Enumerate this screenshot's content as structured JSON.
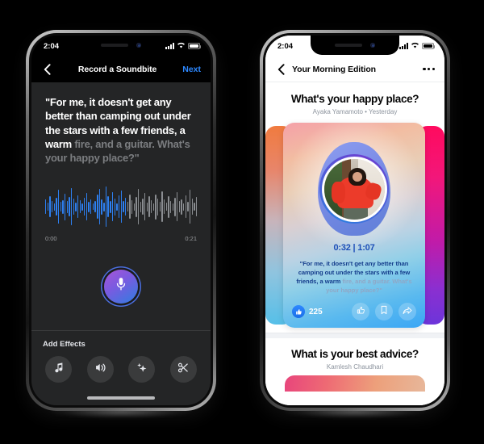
{
  "status_bar": {
    "time": "2:04",
    "signal_icon": "cellular-bars-icon",
    "wifi_icon": "wifi-icon",
    "battery_icon": "battery-icon"
  },
  "left_phone": {
    "nav": {
      "back_icon": "back-chevron-icon",
      "title": "Record a Soundbite",
      "next_label": "Next"
    },
    "transcript": {
      "spoken": "\"For me, it doesn't get any better than camping out under the stars with a few friends, a warm ",
      "remaining": "fire, and a guitar. What's your happy place?\""
    },
    "waveform": {
      "start_time": "0:00",
      "end_time": "0:21",
      "played_color": "#2d7ff0",
      "unplayed_color": "#8a8d91",
      "played_count": 38,
      "heights": [
        18,
        10,
        26,
        14,
        9,
        22,
        42,
        12,
        17,
        33,
        15,
        24,
        46,
        20,
        11,
        28,
        16,
        9,
        22,
        34,
        13,
        18,
        8,
        14,
        30,
        44,
        19,
        11,
        50,
        26,
        15,
        36,
        21,
        9,
        28,
        40,
        14,
        22,
        12,
        30,
        17,
        9,
        25,
        44,
        13,
        20,
        34,
        11,
        26,
        16,
        9,
        31,
        21,
        12,
        38,
        18,
        10,
        27,
        15,
        9,
        23,
        36,
        14,
        19,
        9,
        28,
        12,
        42,
        20,
        10,
        24
      ]
    },
    "record_button": {
      "icon": "microphone-icon",
      "gradient_from": "#a855d6",
      "gradient_to": "#2f7de0"
    },
    "effects": {
      "label": "Add Effects",
      "items": [
        {
          "icon": "music-note-icon",
          "name": "music"
        },
        {
          "icon": "sound-effects-icon",
          "name": "sound-effects"
        },
        {
          "icon": "sparkles-icon",
          "name": "voice-effects"
        },
        {
          "icon": "scissors-icon",
          "name": "trim"
        }
      ]
    }
  },
  "right_phone": {
    "nav": {
      "back_icon": "back-chevron-icon",
      "title": "Your Morning Edition",
      "more_icon": "more-options-icon"
    },
    "question": {
      "title": "What's your happy place?",
      "author": "Ayaka Yamamoto",
      "separator": "•",
      "date": "Yesterday",
      "meta": "Ayaka Yamamoto • Yesterday"
    },
    "card": {
      "timecode": "0:32 | 1:07",
      "elapsed": "0:32",
      "duration": "1:07",
      "avatar_icon": "user-avatar",
      "transcript": {
        "spoken": "\"For me, it doesn't get any better than camping out under the stars with a few friends, a warm ",
        "remaining": "fire, and a guitar. What's your happy place?\""
      },
      "like_count": "225",
      "like_badge_icon": "thumbs-up-filled-icon",
      "actions": [
        {
          "icon": "thumbs-up-icon",
          "name": "like"
        },
        {
          "icon": "bookmark-icon",
          "name": "save"
        },
        {
          "icon": "share-arrow-icon",
          "name": "share"
        }
      ]
    },
    "next_question": {
      "title": "What is your best advice?",
      "author": "Kamlesh Chaudhari"
    }
  }
}
